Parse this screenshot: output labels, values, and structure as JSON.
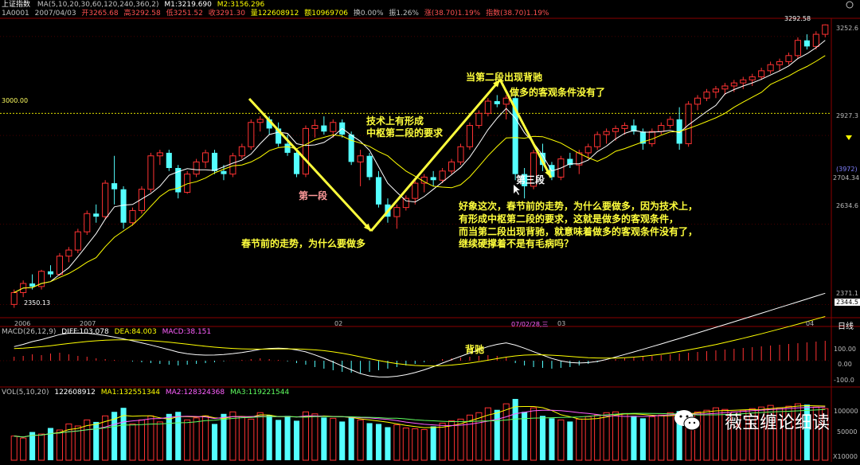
{
  "header": {
    "title": "上证指数",
    "ma_params": "MA(5,10,20,30,60,120,240,360,2)",
    "ma_m1": "M1:3219.690",
    "ma_m2": "M2:3156.296",
    "code": "1A0001",
    "date": "2007/04/03",
    "open": "开3265.68",
    "high": "高3292.58",
    "low": "低3251.52",
    "close": "收3291.30",
    "volume": "量122608912",
    "amount": "额10969706",
    "turnover": "换0.00%",
    "amplitude": "振1.26%",
    "rise": "涨(38.70)1.19%",
    "index_change": "指数(38.70)1.19%"
  },
  "price_axis": {
    "labels": [
      "3252.6",
      "2927.3",
      "2704.34",
      "2634.6",
      "2371.1",
      "2344.5"
    ],
    "cross_label": "(3972)",
    "level_3000": "3000.00",
    "high_label": "3292.58",
    "low_label": "2350.13"
  },
  "date_axis": {
    "labels": [
      "2006",
      "2007",
      "02",
      "03",
      "04"
    ],
    "cursor_date": "07/02/28,三",
    "unit": "日线"
  },
  "macd": {
    "title": "MACD(26,12,9)",
    "diff": "DIFF:103.078",
    "dea": "DEA:84.003",
    "macd": "MACD:38.151",
    "axis": [
      "100.00",
      "0.00",
      "-100.0"
    ],
    "note": "背驰"
  },
  "vol": {
    "title": "VOL(5,10,20)",
    "value": "122608912",
    "ma1": "MA1:132551344",
    "ma2": "MA2:128324368",
    "ma3": "MA3:119221544",
    "axis": [
      "100000",
      "50000",
      "X10000"
    ]
  },
  "annotations": {
    "first_segment": "第一段",
    "pre_festival": "春节前的走势，为什么要做多",
    "tech_line1": "技术上有形成",
    "tech_line2": "中枢第二段的要求",
    "divergence": "当第二段出现背驰",
    "no_long": "做多的客观条件没有了",
    "third_segment": "第三段",
    "paragraph": [
      "好象这次，春节前的走势，为什么要做多，因为技术上，",
      "有形成中枢第二段的要求，这就是做多的客观条件，",
      "而当第二段出现背驰，就意味着做多的客观条件没有了，",
      "继续硬撑着不是有毛病吗？"
    ]
  },
  "watermark": "薇宝缠论细读",
  "colors": {
    "up": "#ff3232",
    "down": "#54ffff",
    "grid": "#8b0000",
    "ma_white": "#ffffff",
    "ma_yellow": "#ffff00",
    "ann_yellow": "#ffff3c",
    "ann_pink": "#ff9a9a"
  },
  "candles": [
    [
      2371,
      2420,
      2360,
      2410
    ],
    [
      2410,
      2450,
      2395,
      2440
    ],
    [
      2440,
      2470,
      2420,
      2430
    ],
    [
      2430,
      2485,
      2420,
      2480
    ],
    [
      2480,
      2500,
      2460,
      2470
    ],
    [
      2470,
      2540,
      2465,
      2530
    ],
    [
      2530,
      2560,
      2510,
      2550
    ],
    [
      2550,
      2620,
      2540,
      2610
    ],
    [
      2610,
      2680,
      2600,
      2670
    ],
    [
      2670,
      2700,
      2640,
      2660
    ],
    [
      2660,
      2780,
      2650,
      2770
    ],
    [
      2770,
      2860,
      2700,
      2750
    ],
    [
      2750,
      2760,
      2620,
      2640
    ],
    [
      2640,
      2690,
      2630,
      2680
    ],
    [
      2680,
      2760,
      2670,
      2750
    ],
    [
      2750,
      2870,
      2740,
      2860
    ],
    [
      2860,
      2880,
      2830,
      2870
    ],
    [
      2870,
      2880,
      2810,
      2820
    ],
    [
      2820,
      2830,
      2720,
      2740
    ],
    [
      2740,
      2810,
      2735,
      2800
    ],
    [
      2800,
      2850,
      2790,
      2840
    ],
    [
      2840,
      2880,
      2820,
      2870
    ],
    [
      2870,
      2880,
      2800,
      2810
    ],
    [
      2810,
      2830,
      2780,
      2800
    ],
    [
      2800,
      2870,
      2790,
      2860
    ],
    [
      2860,
      2900,
      2850,
      2890
    ],
    [
      2890,
      2980,
      2880,
      2970
    ],
    [
      2970,
      2990,
      2940,
      2980
    ],
    [
      2980,
      2990,
      2930,
      2950
    ],
    [
      2950,
      2970,
      2890,
      2900
    ],
    [
      2900,
      2930,
      2860,
      2870
    ],
    [
      2870,
      2880,
      2790,
      2800
    ],
    [
      2800,
      2960,
      2790,
      2950
    ],
    [
      2950,
      2980,
      2920,
      2960
    ],
    [
      2960,
      2990,
      2930,
      2940
    ],
    [
      2940,
      2980,
      2920,
      2970
    ],
    [
      2970,
      2980,
      2920,
      2930
    ],
    [
      2930,
      2940,
      2830,
      2840
    ],
    [
      2840,
      2880,
      2760,
      2860
    ],
    [
      2860,
      2870,
      2780,
      2790
    ],
    [
      2790,
      2810,
      2690,
      2700
    ],
    [
      2700,
      2720,
      2640,
      2660
    ],
    [
      2660,
      2700,
      2620,
      2690
    ],
    [
      2690,
      2730,
      2680,
      2720
    ],
    [
      2720,
      2780,
      2700,
      2770
    ],
    [
      2770,
      2800,
      2740,
      2790
    ],
    [
      2790,
      2810,
      2760,
      2780
    ],
    [
      2780,
      2820,
      2770,
      2810
    ],
    [
      2810,
      2850,
      2800,
      2840
    ],
    [
      2840,
      2900,
      2830,
      2890
    ],
    [
      2890,
      2970,
      2880,
      2960
    ],
    [
      2960,
      3010,
      2950,
      3000
    ],
    [
      3000,
      3050,
      2990,
      3040
    ],
    [
      3040,
      3060,
      3020,
      3030
    ],
    [
      3030,
      3060,
      2980,
      3050
    ],
    [
      3050,
      3070,
      2780,
      2800
    ],
    [
      2800,
      2820,
      2720,
      2760
    ],
    [
      2760,
      2880,
      2750,
      2870
    ],
    [
      2870,
      2900,
      2810,
      2830
    ],
    [
      2830,
      2840,
      2780,
      2790
    ],
    [
      2790,
      2860,
      2780,
      2850
    ],
    [
      2850,
      2870,
      2820,
      2830
    ],
    [
      2830,
      2880,
      2800,
      2870
    ],
    [
      2870,
      2900,
      2850,
      2890
    ],
    [
      2890,
      2940,
      2880,
      2930
    ],
    [
      2930,
      2950,
      2900,
      2940
    ],
    [
      2940,
      2960,
      2910,
      2950
    ],
    [
      2950,
      2970,
      2930,
      2960
    ],
    [
      2960,
      2980,
      2930,
      2940
    ],
    [
      2940,
      2950,
      2880,
      2900
    ],
    [
      2900,
      2950,
      2890,
      2940
    ],
    [
      2940,
      2970,
      2930,
      2960
    ],
    [
      2960,
      2990,
      2950,
      2980
    ],
    [
      2980,
      3020,
      2880,
      2900
    ],
    [
      2900,
      3040,
      2890,
      3030
    ],
    [
      3030,
      3060,
      3010,
      3050
    ],
    [
      3050,
      3080,
      3040,
      3070
    ],
    [
      3070,
      3090,
      3050,
      3080
    ],
    [
      3080,
      3100,
      3060,
      3090
    ],
    [
      3090,
      3110,
      3070,
      3100
    ],
    [
      3100,
      3120,
      3080,
      3110
    ],
    [
      3110,
      3130,
      3090,
      3120
    ],
    [
      3120,
      3150,
      3110,
      3140
    ],
    [
      3140,
      3170,
      3130,
      3160
    ],
    [
      3160,
      3180,
      3140,
      3170
    ],
    [
      3170,
      3200,
      3160,
      3190
    ],
    [
      3190,
      3250,
      3180,
      3240
    ],
    [
      3240,
      3260,
      3210,
      3220
    ],
    [
      3220,
      3270,
      3210,
      3260
    ],
    [
      3260,
      3293,
      3250,
      3291
    ]
  ],
  "volumes": [
    60,
    55,
    70,
    65,
    80,
    75,
    90,
    85,
    100,
    95,
    110,
    120,
    130,
    90,
    100,
    110,
    95,
    115,
    120,
    100,
    105,
    110,
    90,
    115,
    120,
    108,
    102,
    118,
    112,
    100,
    110,
    98,
    120,
    115,
    106,
    104,
    96,
    108,
    100,
    92,
    90,
    82,
    88,
    80,
    78,
    76,
    84,
    92,
    98,
    102,
    112,
    118,
    130,
    125,
    140,
    152,
    120,
    130,
    110,
    104,
    100,
    96,
    102,
    108,
    112,
    118,
    120,
    116,
    110,
    104,
    108,
    112,
    118,
    122,
    116,
    120,
    124,
    130,
    126,
    120,
    124,
    128,
    132,
    136,
    130,
    134,
    140,
    138,
    132,
    128
  ],
  "macd_bars": [
    5,
    6,
    8,
    7,
    9,
    10,
    8,
    6,
    5,
    3,
    2,
    1,
    0,
    -1,
    -2,
    -3,
    -4,
    -5,
    -6,
    -5,
    -4,
    -3,
    -2,
    -1,
    0,
    1,
    2,
    3,
    2,
    1,
    -1,
    -3,
    -5,
    -8,
    -10,
    -12,
    -14,
    -15,
    -16,
    -14,
    -12,
    -10,
    -8,
    -6,
    -4,
    -2,
    0,
    2,
    3,
    4,
    5,
    6,
    7,
    6,
    5,
    -3,
    -6,
    -8,
    -9,
    -10,
    -9,
    -8,
    -6,
    -4,
    -2,
    0,
    2,
    3,
    4,
    5,
    6,
    7,
    8,
    9,
    10,
    11,
    12,
    13,
    14,
    15,
    16,
    17,
    18,
    19,
    20,
    21,
    22,
    23,
    24,
    25
  ]
}
